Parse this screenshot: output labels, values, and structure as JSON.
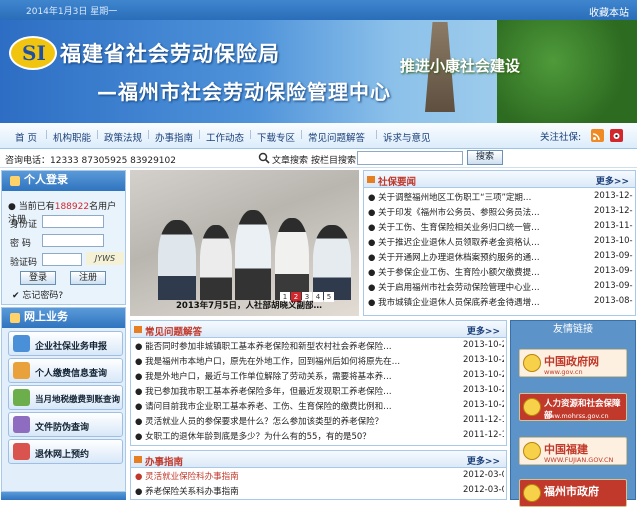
{
  "topbar": {
    "date": "2014年1月3日 星期一",
    "favorite": "收藏本站"
  },
  "banner": {
    "logo_text": "SI",
    "title": "福建省社会劳动保险局",
    "subtitle": "—福州市社会劳动保险管理中心",
    "slogan": "推进小康社会建设"
  },
  "nav": {
    "items": [
      "首  页",
      "机构职能",
      "政策法规",
      "办事指南",
      "工作动态",
      "下载专区",
      "常见问题解答",
      "诉求与意见"
    ],
    "follow_label": "关注社保:"
  },
  "contact": {
    "phone": "咨询电话：12333 87305925 83929102",
    "search_article": "文章搜索",
    "search_column": "按栏目搜索",
    "search_placeholder": "",
    "search_button": "搜索"
  },
  "login": {
    "title": "个人登录",
    "count_prefix": "当前已有",
    "count": "188922",
    "count_suffix": "名用户注册",
    "id_label": "身份证",
    "password_label": "密  码",
    "captcha_label": "验证码",
    "captcha_image": "JYWS",
    "login_button": "登录",
    "register_button": "注册",
    "forgot": "忘记密码?"
  },
  "online": {
    "title": "网上业务",
    "services": [
      {
        "label": "企业社保业务申报",
        "icon": "monitor-icon"
      },
      {
        "label": "个人缴费信息查询",
        "icon": "person-search-icon"
      },
      {
        "label": "当月地税缴费到账查询",
        "icon": "book-icon"
      },
      {
        "label": "文件防伪查询",
        "icon": "magnifier-icon"
      },
      {
        "label": "退休网上预约",
        "icon": "calendar-icon"
      }
    ]
  },
  "slideshow": {
    "caption": "2013年7月5日，人社部胡晓义副部…",
    "pages": [
      "1",
      "2",
      "3",
      "4",
      "5"
    ],
    "active": 1
  },
  "news": {
    "title": "社保要闻",
    "more": "更多>>",
    "items": [
      {
        "text": "关于调整福州地区工伤职工“三项”定期…",
        "date": "2013-12-16"
      },
      {
        "text": "关于印发《福州市公务员、参照公务员法…",
        "date": "2013-12-05"
      },
      {
        "text": "关于工伤、生育保险相关业务归口统一管…",
        "date": "2013-11-25"
      },
      {
        "text": "关于推迟企业退休人员领取养老金资格认…",
        "date": "2013-10-28"
      },
      {
        "text": "关于开通网上办理退休档案预约服务的通…",
        "date": "2013-09-30"
      },
      {
        "text": "关于参保企业工伤、生育险小额欠缴费提…",
        "date": "2013-09-09"
      },
      {
        "text": "关于启用福州市社会劳动保险管理中心业…",
        "date": "2013-09-03"
      },
      {
        "text": "我市城镇企业退休人员保底养老金待遇增…",
        "date": "2013-08-22"
      }
    ]
  },
  "faq": {
    "title": "常见问题解答",
    "more": "更多>>",
    "items": [
      {
        "text": "能否同时参加非城镇职工基本养老保险和新型农村社会养老保险…",
        "date": "2013-10-29"
      },
      {
        "text": "我是福州市本地户口，原先在外地工作，回到福州后如何将原先在…",
        "date": "2013-10-28"
      },
      {
        "text": "我是外地户口，最近与工作单位解除了劳动关系，需要将基本养…",
        "date": "2013-10-29"
      },
      {
        "text": "我已参加我市职工基本养老保险多年，但最近发现职工养老保险…",
        "date": "2013-10-29"
      },
      {
        "text": "请问目前我市企业职工基本养老、工伤、生育保险的缴费比例和…",
        "date": "2013-10-29"
      },
      {
        "text": "灵活就业人员的参保要求是什么？怎么参加该类型的养老保险？",
        "date": "2011-12-12"
      },
      {
        "text": "女职工的退休年龄到底是多少？为什么有的55，有的是50？",
        "date": "2011-12-12"
      }
    ]
  },
  "banshi": {
    "title": "办事指南",
    "more": "更多>>",
    "items": [
      {
        "text": "灵活就业保险科办事指南",
        "date": "2012-03-05",
        "color": "#c0392b"
      },
      {
        "text": "养老保险关系科办事指南",
        "date": "2012-03-05",
        "color": "#222222"
      }
    ]
  },
  "friends": {
    "title": "友情链接",
    "links": [
      {
        "name": "中国政府网",
        "url_text": "www.gov.cn",
        "bg": "#fdf0e0",
        "color": "#c0392b"
      },
      {
        "name": "人力资源和社会保障部",
        "url_text": "www.mohrss.gov.cn",
        "bg": "#c0392b",
        "color": "#ffffff"
      },
      {
        "name": "中国福建",
        "url_text": "WWW.FUJIAN.GOV.CN",
        "bg": "#fdf0e0",
        "color": "#c0392b"
      },
      {
        "name": "福州市政府",
        "url_text": "",
        "bg": "#c0392b",
        "color": "#ffffff"
      }
    ]
  },
  "colors": {
    "accent": "#2f74bf",
    "highlight": "#d2272d"
  }
}
